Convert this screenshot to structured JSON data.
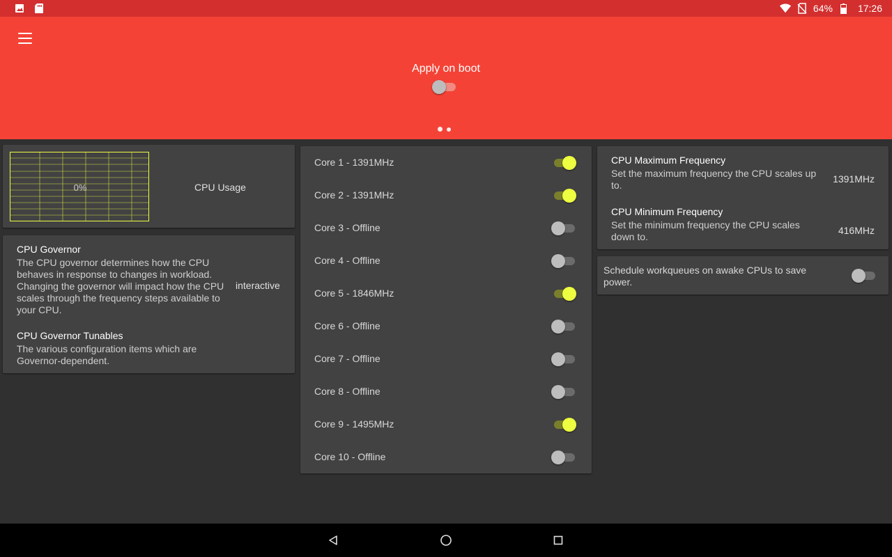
{
  "status_bar": {
    "battery": "64%",
    "time": "17:26",
    "icons": [
      "image-icon",
      "sd-card-icon",
      "wifi-icon",
      "no-sim-icon",
      "battery-icon"
    ]
  },
  "header": {
    "apply_on_boot_label": "Apply on boot",
    "apply_on_boot_enabled": false,
    "page_count": 2,
    "active_page": 1
  },
  "cpu_usage": {
    "graph_value": "0%",
    "label": "CPU Usage"
  },
  "governor": {
    "title": "CPU Governor",
    "desc": "The CPU governor determines how the CPU behaves in response to changes in workload. Changing the governor will impact how the CPU scales through the frequency steps available to your CPU.",
    "value": "interactive",
    "tunables_title": "CPU Governor Tunables",
    "tunables_desc": "The various configuration items which are Governor-dependent."
  },
  "cores": [
    {
      "label": "Core 1 - 1391MHz",
      "on": true
    },
    {
      "label": "Core 2 - 1391MHz",
      "on": true
    },
    {
      "label": "Core 3 - Offline",
      "on": false
    },
    {
      "label": "Core 4 - Offline",
      "on": false
    },
    {
      "label": "Core 5 - 1846MHz",
      "on": true
    },
    {
      "label": "Core 6 - Offline",
      "on": false
    },
    {
      "label": "Core 7 - Offline",
      "on": false
    },
    {
      "label": "Core 8 - Offline",
      "on": false
    },
    {
      "label": "Core 9 - 1495MHz",
      "on": true
    },
    {
      "label": "Core 10 - Offline",
      "on": false
    }
  ],
  "frequency": {
    "max_title": "CPU Maximum Frequency",
    "max_desc": "Set the maximum frequency the CPU scales up to.",
    "max_value": "1391MHz",
    "min_title": "CPU Minimum Frequency",
    "min_desc": "Set the minimum frequency the CPU scales down to.",
    "min_value": "416MHz"
  },
  "workqueues": {
    "label": "Schedule workqueues on awake CPUs to save power.",
    "enabled": false
  },
  "colors": {
    "header": "#f44336",
    "status_bar": "#d32f2f",
    "accent": "#eeff41",
    "card": "#424242",
    "background": "#303030"
  }
}
